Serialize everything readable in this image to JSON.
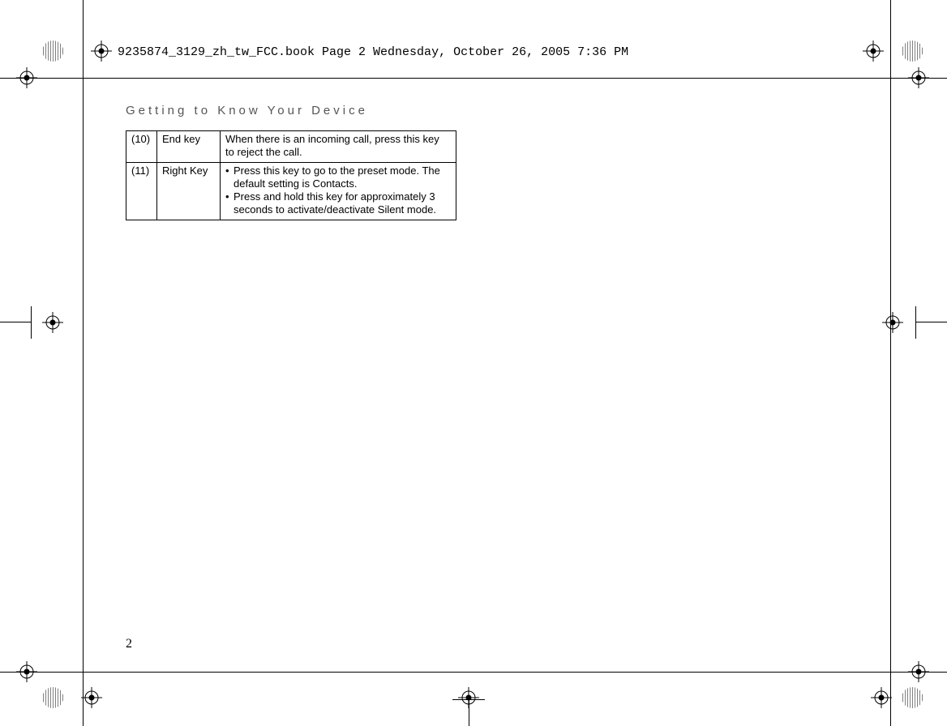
{
  "header": {
    "crop_text": "9235874_3129_zh_tw_FCC.book  Page 2  Wednesday, October 26, 2005  7:36 PM"
  },
  "section_title": "Getting to Know Your Device",
  "table": {
    "rows": [
      {
        "num": "(10)",
        "name": "End key",
        "desc_plain": "When there is an incoming call, press this key to reject the call.",
        "bullets": []
      },
      {
        "num": "(11)",
        "name": "Right Key",
        "desc_plain": "",
        "bullets": [
          "Press this key to go to the preset mode. The default setting is Contacts.",
          "Press and hold this key for approximately 3 seconds to activate/deactivate Silent mode."
        ]
      }
    ]
  },
  "page_number": "2"
}
